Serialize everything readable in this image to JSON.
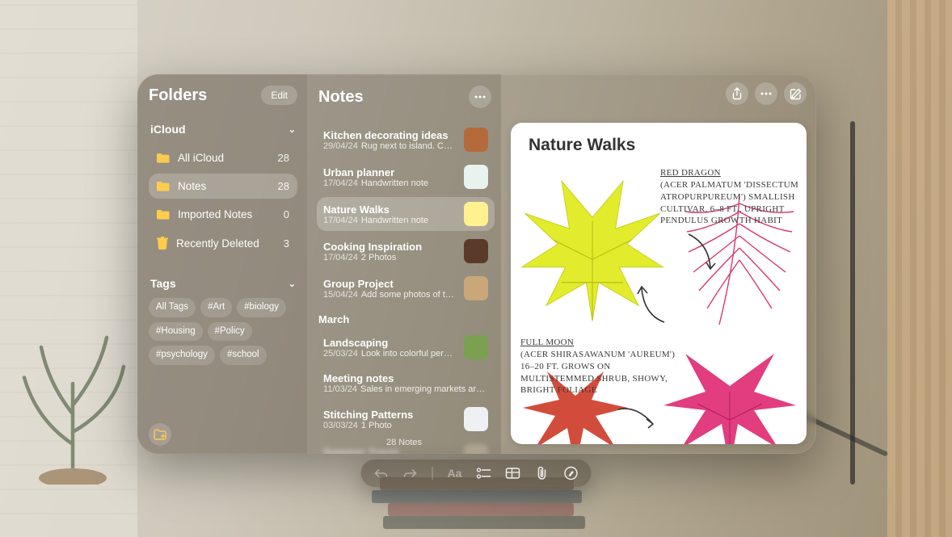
{
  "sidebar": {
    "title": "Folders",
    "edit_label": "Edit",
    "account": "iCloud",
    "folders": [
      {
        "name": "All iCloud",
        "count": 28,
        "icon": "folder"
      },
      {
        "name": "Notes",
        "count": 28,
        "icon": "folder",
        "selected": true
      },
      {
        "name": "Imported Notes",
        "count": 0,
        "icon": "folder"
      },
      {
        "name": "Recently Deleted",
        "count": 3,
        "icon": "trash"
      }
    ],
    "tags_header": "Tags",
    "tags": [
      "All Tags",
      "#Art",
      "#biology",
      "#Housing",
      "#Policy",
      "#psychology",
      "#school"
    ]
  },
  "list": {
    "title": "Notes",
    "footer": "28 Notes",
    "groups": [
      {
        "label": null,
        "items": [
          {
            "title": "Kitchen decorating ideas",
            "date": "29/04/24",
            "preview": "Rug next to island. Conte…",
            "thumb": "#b56a3a"
          },
          {
            "title": "Urban planner",
            "date": "17/04/24",
            "preview": "Handwritten note",
            "thumb": "#e8f2ef"
          },
          {
            "title": "Nature Walks",
            "date": "17/04/24",
            "preview": "Handwritten note",
            "thumb": "#fff090",
            "selected": true
          },
          {
            "title": "Cooking Inspiration",
            "date": "17/04/24",
            "preview": "2 Photos",
            "thumb": "#5a3b2a"
          },
          {
            "title": "Group Project",
            "date": "15/04/24",
            "preview": "Add some photos of their…",
            "thumb": "#c9a779"
          }
        ]
      },
      {
        "label": "March",
        "items": [
          {
            "title": "Landscaping",
            "date": "25/03/24",
            "preview": "Look into colorful perenn…",
            "thumb": "#7aa050"
          },
          {
            "title": "Meeting notes",
            "date": "11/03/24",
            "preview": "Sales in emerging markets are tr…",
            "thumb": null
          },
          {
            "title": "Stitching Patterns",
            "date": "03/03/24",
            "preview": "1 Photo",
            "thumb": "#eef0f3"
          },
          {
            "title": "Summer Travel",
            "date": "",
            "preview": "",
            "thumb": "#c2b8a0",
            "blurred": true
          }
        ]
      }
    ]
  },
  "detail": {
    "title": "Nature Walks",
    "annotations": {
      "red_dragon_title": "RED DRAGON",
      "red_dragon_body": "(ACER PALMATUM 'DISSECTUM ATROPURPUREUM') SMALLISH CULTIVAR, 6–8 FT., UPRIGHT PENDULUS GROWTH HABIT",
      "full_moon_title": "FULL MOON",
      "full_moon_body": "(ACER SHIRASAWANUM 'AUREUM') 16–20 FT. GROWS ON MULTISTEMMED SHRUB, SHOWY, BRIGHT FOLIAGE"
    }
  },
  "toolbar": [
    "undo",
    "redo",
    "format",
    "checklist",
    "table",
    "attach",
    "handwriting"
  ],
  "header_buttons": [
    "share",
    "more",
    "compose"
  ]
}
